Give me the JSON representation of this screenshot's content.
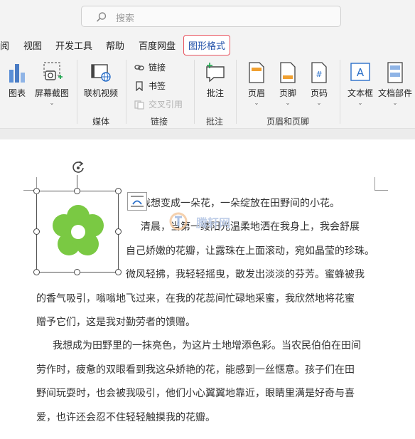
{
  "search": {
    "placeholder": "搜索"
  },
  "menu": {
    "tabs": [
      "阅",
      "视图",
      "开发工具",
      "帮助",
      "百度网盘",
      "图形格式"
    ],
    "active": "图形格式"
  },
  "ribbon": {
    "chart": "图表",
    "screenshot": "屏幕截图",
    "online_video": "联机视频",
    "link": "链接",
    "bookmark": "书签",
    "cross_ref": "交叉引用",
    "comment": "批注",
    "header": "页眉",
    "footer": "页脚",
    "page_number": "页码",
    "textbox": "文本框",
    "doc_parts": "文档部件",
    "groups": {
      "media": "媒体",
      "links": "链接",
      "comments": "批注",
      "header_footer": "页眉和页脚"
    }
  },
  "document": {
    "lines": [
      "我想变成一朵花，一朵绽放在田野间的小花。",
      "清晨，当第一缕阳光温柔地洒在我身上，我会舒展",
      "自己娇嫩的花瓣，让露珠在上面滚动，宛如晶莹的珍珠。",
      "微风轻拂，我轻轻摇曳，散发出淡淡的芬芳。蜜蜂被我",
      "的香气吸引，嗡嗡地飞过来，在我的花蕊间忙碌地采蜜，我欣然地将花蜜",
      "赠予它们，这是我对勤劳者的馈赠。",
      "我想成为田野里的一抹亮色，为这片土地增添色彩。当农民伯伯在田间",
      "劳作时，疲惫的双眼看到我这朵娇艳的花，能感到一丝惬意。孩子们在田",
      "野间玩耍时，也会被我吸引，他们小心翼翼地靠近，眼睛里满是好奇与喜",
      "爱，也许还会忍不住轻轻触摸我的花瓣。"
    ],
    "watermark": "腾轩网"
  },
  "colors": {
    "flower": "#7ac943",
    "active_tab_border": "#e8535f",
    "accent_blue": "#1f4fa8"
  }
}
